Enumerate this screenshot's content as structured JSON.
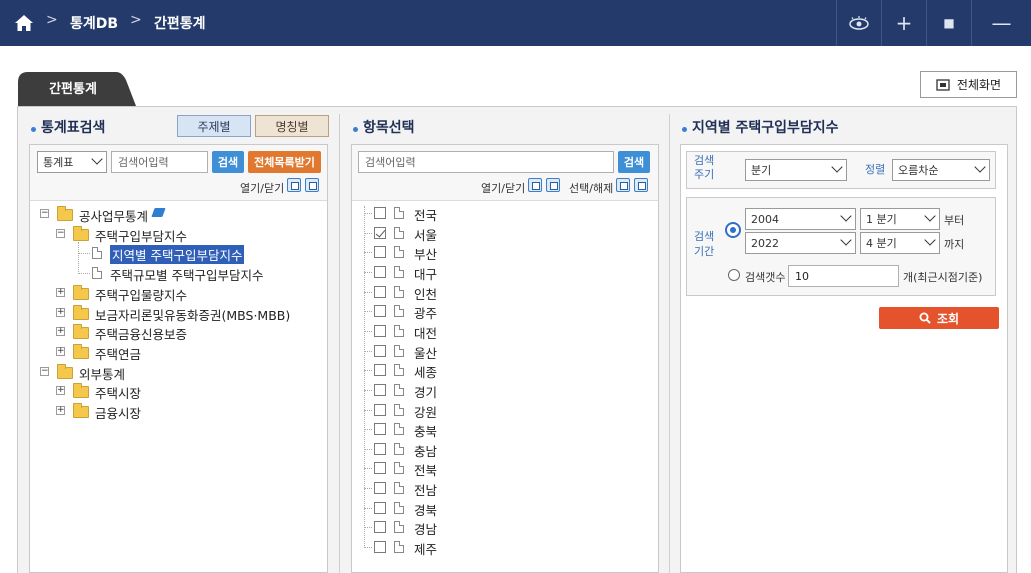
{
  "breadcrumb": {
    "home": "home",
    "items": [
      "통계DB",
      "간편통계"
    ]
  },
  "toolbar": {
    "icons": [
      "eye-icon",
      "plus-icon",
      "square-icon",
      "minus-icon"
    ],
    "plus": "+",
    "square": "■",
    "minus": "—"
  },
  "tab": {
    "label": "간편통계"
  },
  "fullscreen": {
    "label": "전체화면"
  },
  "panel1": {
    "title": "통계표검색",
    "toggle_subject": "주제별",
    "toggle_name": "명칭별",
    "select_value": "통계표",
    "search_placeholder": "검색어입력",
    "search_btn": "검색",
    "full_list_btn": "전체목록받기",
    "open_close": "열기/닫기",
    "tree": [
      {
        "label": "공사업무통계",
        "level": 0,
        "type": "folder",
        "expanded": true
      },
      {
        "label": "주택구입부담지수",
        "level": 1,
        "type": "folder",
        "expanded": true
      },
      {
        "label": "지역별 주택구입부담지수",
        "level": 2,
        "type": "doc",
        "selected": true
      },
      {
        "label": "주택규모별 주택구입부담지수",
        "level": 2,
        "type": "doc"
      },
      {
        "label": "주택구입물량지수",
        "level": 1,
        "type": "folder"
      },
      {
        "label": "보금자리론및유동화증권(MBS·MBB)",
        "level": 1,
        "type": "folder"
      },
      {
        "label": "주택금융신용보증",
        "level": 1,
        "type": "folder"
      },
      {
        "label": "주택연금",
        "level": 1,
        "type": "folder"
      },
      {
        "label": "외부통계",
        "level": 0,
        "type": "folder",
        "expanded": true
      },
      {
        "label": "주택시장",
        "level": 1,
        "type": "folder"
      },
      {
        "label": "금융시장",
        "level": 1,
        "type": "folder"
      }
    ]
  },
  "panel2": {
    "title": "항목선택",
    "search_placeholder": "검색어입력",
    "search_btn": "검색",
    "open_close": "열기/닫기",
    "select_clear": "선택/해제",
    "items": [
      {
        "label": "전국",
        "checked": false
      },
      {
        "label": "서울",
        "checked": true
      },
      {
        "label": "부산",
        "checked": false
      },
      {
        "label": "대구",
        "checked": false
      },
      {
        "label": "인천",
        "checked": false
      },
      {
        "label": "광주",
        "checked": false
      },
      {
        "label": "대전",
        "checked": false
      },
      {
        "label": "울산",
        "checked": false
      },
      {
        "label": "세종",
        "checked": false
      },
      {
        "label": "경기",
        "checked": false
      },
      {
        "label": "강원",
        "checked": false
      },
      {
        "label": "충북",
        "checked": false
      },
      {
        "label": "충남",
        "checked": false
      },
      {
        "label": "전북",
        "checked": false
      },
      {
        "label": "전남",
        "checked": false
      },
      {
        "label": "경북",
        "checked": false
      },
      {
        "label": "경남",
        "checked": false
      },
      {
        "label": "제주",
        "checked": false
      }
    ]
  },
  "panel3": {
    "title": "지역별 주택구입부담지수",
    "period_label_1": "검색",
    "period_label_2": "주기",
    "period_value": "분기",
    "sort_label": "정렬",
    "sort_value": "오름차순",
    "range_label_1": "검색",
    "range_label_2": "기간",
    "from_year": "2004",
    "from_quarter": "1 분기",
    "from_suffix": "부터",
    "to_year": "2022",
    "to_quarter": "4 분기",
    "to_suffix": "까지",
    "count_label": "검색갯수",
    "count_value": "10",
    "count_suffix": "개(최근시점기준)",
    "query_btn": "조회"
  }
}
